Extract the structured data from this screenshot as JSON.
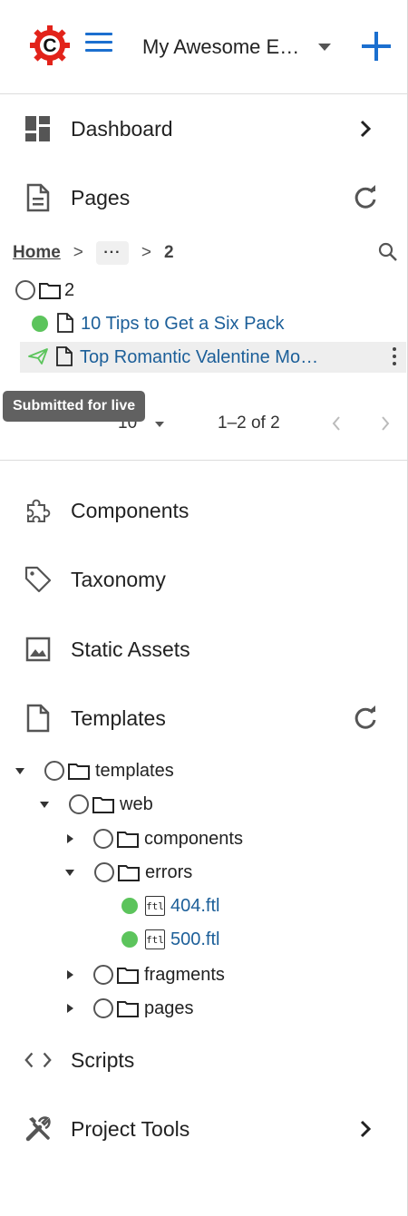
{
  "header": {
    "site_name": "My Awesome E…",
    "logo_letter": "C",
    "brand_red": "#e2231a",
    "accent_blue": "#1b6fcf"
  },
  "nav": {
    "dashboard": "Dashboard",
    "pages": "Pages",
    "components": "Components",
    "taxonomy": "Taxonomy",
    "static_assets": "Static Assets",
    "templates": "Templates",
    "scripts": "Scripts",
    "project_tools": "Project Tools"
  },
  "pages_panel": {
    "breadcrumb": {
      "home": "Home",
      "separator": ">",
      "more": "···",
      "current": "2"
    },
    "tree": [
      {
        "label": "2",
        "type": "folder",
        "state": "radio"
      },
      {
        "label": "10 Tips to Get a Six Pack",
        "type": "page",
        "state": "live"
      },
      {
        "label": "Top Romantic Valentine Mo…",
        "type": "page",
        "state": "submitted"
      }
    ],
    "tooltip": "Submitted for live",
    "pagination": {
      "rows_per_page": "10",
      "range": "1–2 of 2"
    }
  },
  "templates_panel": {
    "tree": [
      {
        "label": "templates",
        "expanded": true
      },
      {
        "label": "web",
        "expanded": true
      },
      {
        "label": "components",
        "expanded": false
      },
      {
        "label": "errors",
        "expanded": true
      },
      {
        "label": "404.ftl",
        "file_icon": "ftl",
        "state": "live"
      },
      {
        "label": "500.ftl",
        "file_icon": "ftl",
        "state": "live"
      },
      {
        "label": "fragments",
        "expanded": false
      },
      {
        "label": "pages",
        "expanded": false
      }
    ]
  },
  "colors": {
    "status_live": "#5cc45c",
    "status_submitted": "#5cc45c",
    "link": "#1c5f99"
  }
}
